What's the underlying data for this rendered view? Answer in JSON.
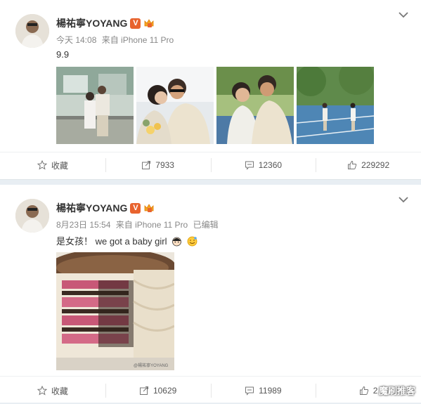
{
  "posts": [
    {
      "author": "楊祐寧YOYANG",
      "time": "今天 14:08",
      "source": "来自 iPhone 11 Pro",
      "edited": "",
      "text": "9.9",
      "images": [
        "photo-1",
        "photo-2",
        "photo-3",
        "photo-4"
      ],
      "actions": {
        "favorite": "收藏",
        "repost": "7933",
        "comment": "12360",
        "like": "229292"
      }
    },
    {
      "author": "楊祐寧YOYANG",
      "time": "8月23日 15:54",
      "source": "来自 iPhone 11 Pro",
      "edited": "已编辑",
      "text": "是女孩！  we got a baby girl",
      "image_caption": "@楊祐寧YOYANG",
      "actions": {
        "favorite": "收藏",
        "repost": "10629",
        "comment": "11989",
        "like": "2"
      }
    }
  ],
  "watermark": "魔刷推客",
  "colors": {
    "badge": "#e8632e",
    "page_bg": "#e8eef3"
  },
  "icons": [
    "star-icon",
    "repost-icon",
    "comment-icon",
    "like-icon",
    "chevron-down-icon",
    "verified-badge-icon",
    "vip-crown-icon"
  ]
}
